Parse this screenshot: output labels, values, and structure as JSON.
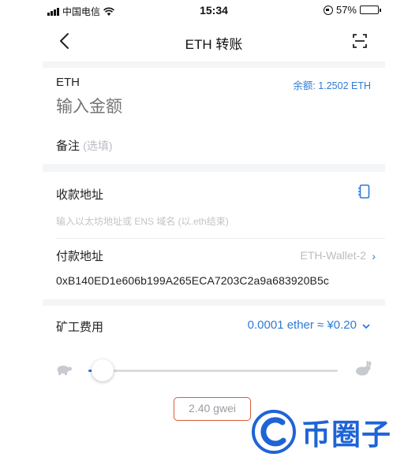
{
  "status_bar": {
    "carrier": "中国电信",
    "time": "15:34",
    "battery_percent": "57%",
    "battery_level": 0.57
  },
  "navbar": {
    "title": "ETH 转账",
    "back_icon": "chevron-left-icon",
    "scan_icon": "scan-icon"
  },
  "amount_section": {
    "token": "ETH",
    "balance_label": "余额: 1.2502 ETH",
    "amount_placeholder": "输入金额",
    "note_label": "备注",
    "note_optional": "(选填)"
  },
  "address_section": {
    "receive_label": "收款地址",
    "contacts_icon": "address-book-icon",
    "receive_placeholder": "输入以太坊地址或 ENS 域名 (以.eth结束)",
    "pay_label": "付款地址",
    "pay_wallet": "ETH-Wallet-2",
    "pay_address": "0xB140ED1e606b199A265ECA7203C2a9a683920B5c"
  },
  "fee_section": {
    "label": "矿工费用",
    "value": "0.0001 ether ≈ ¥0.20",
    "slow_icon": "turtle-icon",
    "fast_icon": "rabbit-icon",
    "slider_level": 0.02,
    "gas_price": "2.40 gwei"
  },
  "watermark": {
    "text": "币圈子"
  },
  "colors": {
    "accent": "#2d7bd7",
    "highlight_border": "#d85a3a",
    "watermark": "#1f64d6"
  }
}
